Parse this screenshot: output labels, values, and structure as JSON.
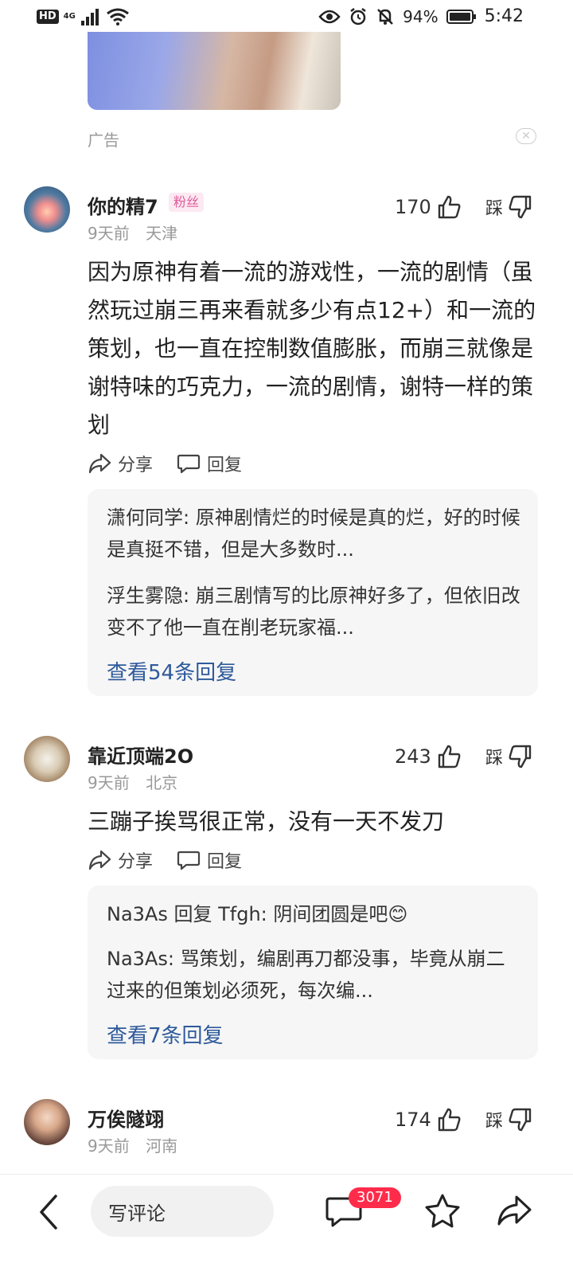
{
  "status_bar": {
    "hd": "HD",
    "network": "4G",
    "battery": "94%",
    "time": "5:42"
  },
  "ad": {
    "label": "广告"
  },
  "comments": [
    {
      "username": "你的精7",
      "badge": "粉丝",
      "time": "9天前",
      "location": "天津",
      "likes": "170",
      "dislike_label": "踩",
      "text": "因为原神有着一流的游戏性，一流的剧情（虽然玩过崩三再来看就多少有点12+）和一流的策划，也一直在控制数值膨胀，而崩三就像是谢特味的巧克力，一流的剧情，谢特一样的策划",
      "share_label": "分享",
      "reply_label": "回复",
      "replies": [
        "潇何同学: 原神剧情烂的时候是真的烂，好的时候是真挺不错，但是大多数时...",
        "浮生雾隐: 崩三剧情写的比原神好多了，但依旧改变不了他一直在削老玩家福..."
      ],
      "view_replies": "查看54条回复"
    },
    {
      "username": "靠近顶端2O",
      "time": "9天前",
      "location": "北京",
      "likes": "243",
      "dislike_label": "踩",
      "text": "三蹦子挨骂很正常，没有一天不发刀",
      "share_label": "分享",
      "reply_label": "回复",
      "replies": [
        "Na3As 回复 Tfgh: 阴间团圆是吧😊",
        "Na3As: 骂策划，编剧再刀都没事，毕竟从崩二过来的但策划必须死，每次编..."
      ],
      "view_replies": "查看7条回复"
    },
    {
      "username": "万俟隧翊",
      "time": "9天前",
      "location": "河南",
      "likes": "174",
      "dislike_label": "踩"
    }
  ],
  "bottom_bar": {
    "input_placeholder": "写评论",
    "comment_count": "3071"
  }
}
